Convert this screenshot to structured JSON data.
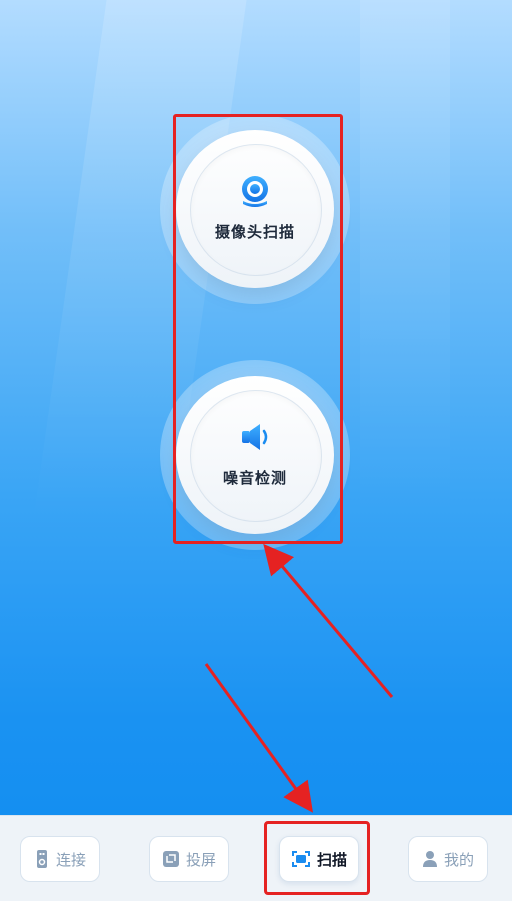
{
  "features": [
    {
      "label": "摄像头扫描",
      "icon": "camera-icon"
    },
    {
      "label": "噪音检测",
      "icon": "speaker-icon"
    }
  ],
  "tabbar": {
    "tabs": [
      {
        "label": "连接",
        "icon": "remote-icon",
        "active": false
      },
      {
        "label": "投屏",
        "icon": "screen-cast-icon",
        "active": false
      },
      {
        "label": "扫描",
        "icon": "scan-icon",
        "active": true
      },
      {
        "label": "我的",
        "icon": "user-icon",
        "active": false
      }
    ]
  },
  "colors": {
    "accent_blue": "#1a8cf0",
    "highlight_red": "#e52222",
    "label_dark": "#1e2a3b",
    "tab_inactive": "#8aa0b8"
  }
}
